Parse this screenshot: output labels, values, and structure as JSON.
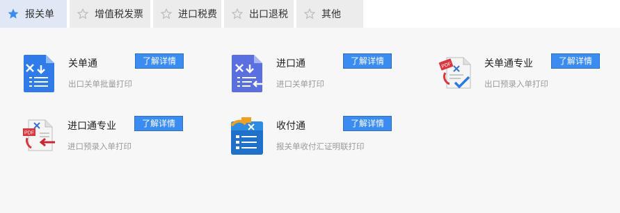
{
  "tabs": [
    {
      "label": "报关单",
      "active": true,
      "icon": "star-filled-icon"
    },
    {
      "label": "增值税发票",
      "active": false,
      "icon": "star-outline-icon"
    },
    {
      "label": "进口税费",
      "active": false,
      "icon": "star-outline-icon"
    },
    {
      "label": "出口退税",
      "active": false,
      "icon": "star-outline-icon"
    },
    {
      "label": "其他",
      "active": false,
      "icon": "star-outline-icon"
    }
  ],
  "colors": {
    "accent": "#3a8cf0",
    "active_tab_bg": "#dfe8f4",
    "tab_bg": "#ececec",
    "content_bg": "#f7f7f7"
  },
  "products": [
    {
      "name": "关单通",
      "desc": "出口关单批量打印",
      "button": "了解详情",
      "icon": "document-download-icon"
    },
    {
      "name": "进口通",
      "desc": "进口关单打印",
      "button": "了解详情",
      "icon": "document-import-icon"
    },
    {
      "name": "关单通专业",
      "desc": "出口预录入单打印",
      "button": "了解详情",
      "icon": "pdf-check-icon"
    },
    {
      "name": "进口通专业",
      "desc": "进口预录入单打印",
      "button": "了解详情",
      "icon": "pdf-arrow-icon"
    },
    {
      "name": "收付通",
      "desc": "报关单收付汇证明联打印",
      "button": "了解详情",
      "icon": "clipboard-list-icon"
    }
  ]
}
